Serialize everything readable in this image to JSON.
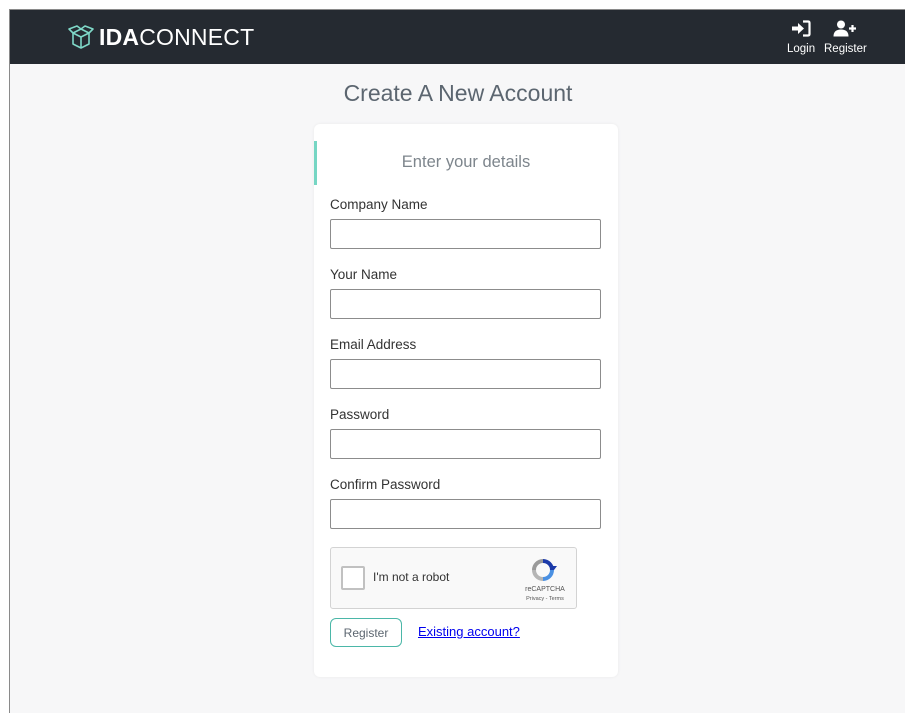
{
  "navbar": {
    "brand_bold": "IDA",
    "brand_thin": "CONNECT",
    "login_label": "Login",
    "register_label": "Register",
    "background_color": "#252a31"
  },
  "page": {
    "title": "Create A New Account"
  },
  "form": {
    "subtitle": "Enter your details",
    "accent_color": "#76d6c4",
    "fields": [
      {
        "label": "Company Name",
        "value": "",
        "placeholder": ""
      },
      {
        "label": "Your Name",
        "value": "",
        "placeholder": ""
      },
      {
        "label": "Email Address",
        "value": "",
        "placeholder": ""
      },
      {
        "label": "Password",
        "value": "",
        "placeholder": ""
      },
      {
        "label": "Confirm Password",
        "value": "",
        "placeholder": ""
      }
    ],
    "captcha": {
      "text": "I'm not a robot",
      "brand": "reCAPTCHA",
      "links": "Privacy - Terms"
    },
    "register_button": "Register",
    "existing_account_link": "Existing account?"
  },
  "icons": {
    "brand": "box-outline-icon",
    "login": "sign-in-icon",
    "register": "user-plus-icon",
    "captcha": "recaptcha-logo-icon"
  }
}
